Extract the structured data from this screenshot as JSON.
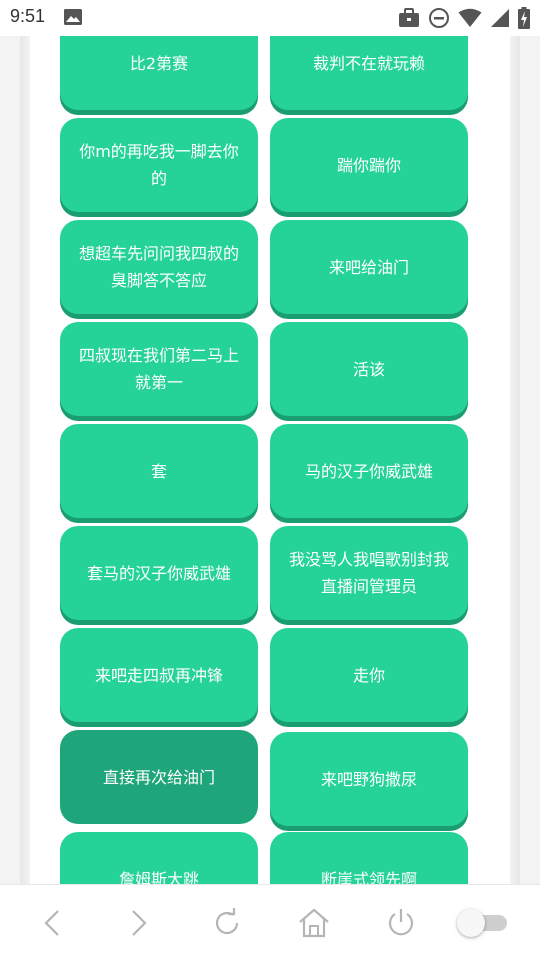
{
  "status_bar": {
    "time": "9:51",
    "left_icons": [
      "image-icon"
    ],
    "right_icons": [
      "briefcase-icon",
      "do-not-disturb-icon",
      "wifi-icon",
      "signal-icon",
      "battery-charging-icon"
    ]
  },
  "sound_buttons": [
    {
      "label": "比2第赛"
    },
    {
      "label": "裁判不在就玩赖"
    },
    {
      "label": "你m的再吃我一脚去你的"
    },
    {
      "label": "踹你踹你"
    },
    {
      "label": "想超车先问问我四叔的臭脚答不答应"
    },
    {
      "label": "来吧给油门"
    },
    {
      "label": "四叔现在我们第二马上就第一"
    },
    {
      "label": "活该"
    },
    {
      "label": "套"
    },
    {
      "label": "马的汉子你威武雄"
    },
    {
      "label": "套马的汉子你威武雄"
    },
    {
      "label": "我没骂人我唱歌别封我直播间管理员"
    },
    {
      "label": "来吧走四叔再冲锋"
    },
    {
      "label": "走你"
    },
    {
      "label": "直接再次给油门",
      "pressed": true
    },
    {
      "label": "来吧野狗撒尿"
    },
    {
      "label": "詹姆斯大跳"
    },
    {
      "label": "断崖式领先啊"
    }
  ],
  "colors": {
    "button": "#25d398",
    "button_shadow": "#1a9d6f",
    "button_pressed": "#1fa57a",
    "icon_gray": "#b5b5b5"
  },
  "bottom_nav": {
    "icons": [
      "back-arrow-icon",
      "forward-arrow-icon",
      "reload-icon",
      "home-icon",
      "power-icon",
      "toggle-switch"
    ]
  }
}
